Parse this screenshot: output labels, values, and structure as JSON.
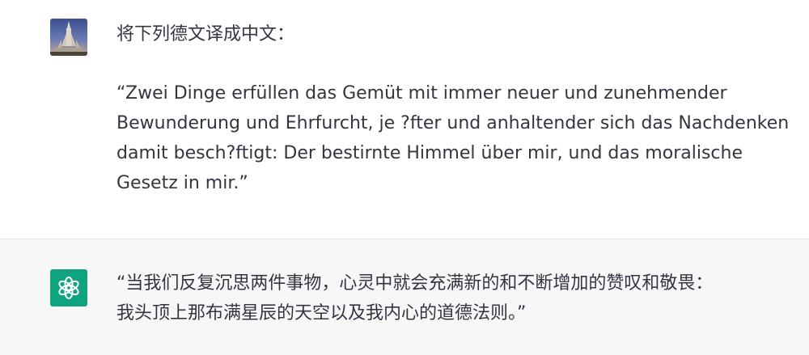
{
  "user_message": {
    "avatar_icon": "cathedral-photo-avatar",
    "lines": [
      "将下列德文译成中文：",
      "“Zwei Dinge erfüllen das Gemüt mit immer neuer und zunehmender",
      "Bewunderung und Ehrfurcht, je ?fter und anhaltender sich das Nachdenken",
      "damit besch?ftigt: Der bestirnte Himmel über mir, und das moralische",
      "Gesetz in mir.”"
    ]
  },
  "assistant_message": {
    "avatar_icon": "openai-logo-icon",
    "avatar_color": "#10a37f",
    "lines": [
      "“当我们反复沉思两件事物，心灵中就会充满新的和不断增加的赞叹和敬畏：",
      "我头顶上那布满星辰的天空以及我内心的道德法则。”"
    ]
  }
}
